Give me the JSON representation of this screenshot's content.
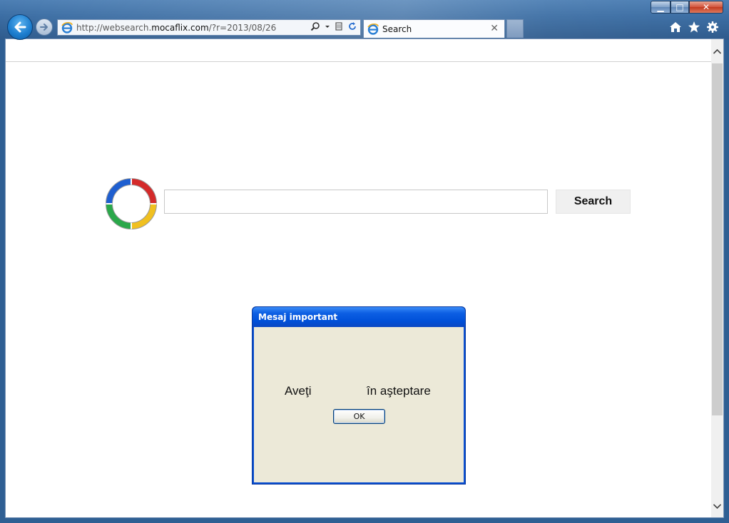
{
  "browser": {
    "address": {
      "url_prefix": "http://websearch.",
      "url_host": "mocaflix.com",
      "url_suffix": "/?r=2013/08/26"
    },
    "tab": {
      "title": "Search",
      "close_glyph": "✕"
    },
    "window_controls": {
      "minimize_glyph": "▁",
      "maximize_glyph": "□",
      "close_glyph": "✕"
    },
    "icons": [
      "back-arrow-icon",
      "forward-arrow-icon",
      "ie-icon",
      "search-icon",
      "dropdown-icon",
      "compat-view-icon",
      "refresh-icon",
      "home-icon",
      "favorites-star-icon",
      "settings-gear-icon"
    ]
  },
  "search": {
    "input_value": "",
    "button_label": "Search"
  },
  "dialog": {
    "title": "Mesaj important",
    "message_left": "Aveţi",
    "message_right": "în aşteptare",
    "ok_label": "OK"
  },
  "colors": {
    "frame": "#2f5f93",
    "dialog_title": "#0050d8",
    "dialog_body": "#ece9d8",
    "logo": [
      "#d42a2a",
      "#f0c020",
      "#2aa84a",
      "#1f5fd0"
    ]
  }
}
